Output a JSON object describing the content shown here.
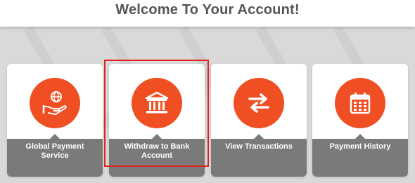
{
  "header": {
    "title": "Welcome To Your Account!"
  },
  "cards": [
    {
      "label": "Global Payment Service",
      "icon": "hand-globe-icon"
    },
    {
      "label": "Withdraw to Bank Account",
      "icon": "bank-icon"
    },
    {
      "label": "View Transactions",
      "icon": "arrows-exchange-icon"
    },
    {
      "label": "Payment History",
      "icon": "calendar-icon"
    }
  ],
  "colors": {
    "accent": "#f04e23",
    "card_footer": "#7a7a7a",
    "highlight": "#e0241b",
    "background": "#d9d9d9"
  }
}
